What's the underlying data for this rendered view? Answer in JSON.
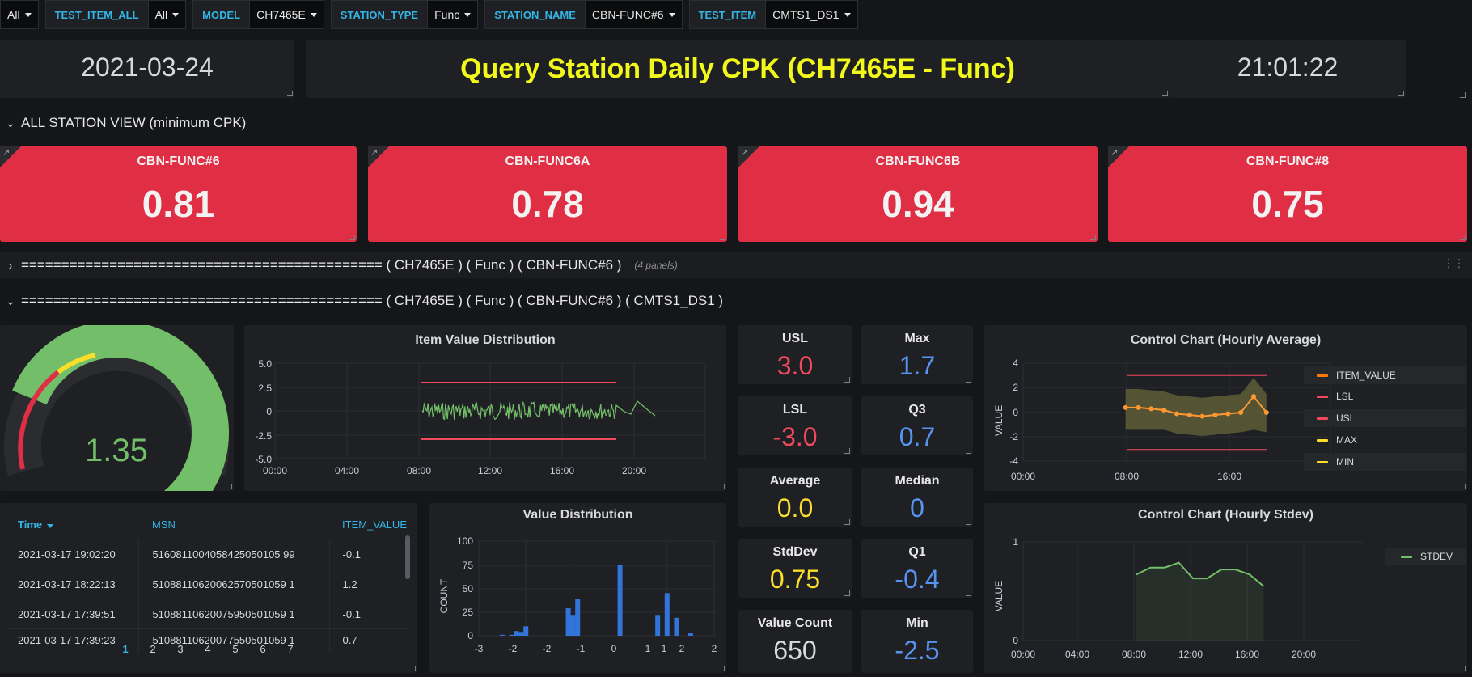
{
  "variables": [
    {
      "label": "",
      "value": "All"
    },
    {
      "label": "TEST_ITEM_ALL",
      "value": "All"
    },
    {
      "label": "MODEL",
      "value": "CH7465E"
    },
    {
      "label": "STATION_TYPE",
      "value": "Func"
    },
    {
      "label": "STATION_NAME",
      "value": "CBN-FUNC#6"
    },
    {
      "label": "TEST_ITEM",
      "value": "CMTS1_DS1"
    }
  ],
  "header": {
    "date": "2021-03-24",
    "title": "Query Station Daily CPK (CH7465E - Func)",
    "time": "21:01:22"
  },
  "rows": {
    "all_station": "ALL STATION VIEW (minimum CPK)",
    "collapsed": "============================================= ( CH7465E ) ( Func ) ( CBN-FUNC#6 )",
    "collapsed_count": "(4 panels)",
    "expanded": "============================================= ( CH7465E ) ( Func ) ( CBN-FUNC#6 ) ( CMTS1_DS1 )"
  },
  "stations": [
    {
      "name": "CBN-FUNC#6",
      "value": "0.81"
    },
    {
      "name": "CBN-FUNC6A",
      "value": "0.78"
    },
    {
      "name": "CBN-FUNC6B",
      "value": "0.94"
    },
    {
      "name": "CBN-FUNC#8",
      "value": "0.75"
    }
  ],
  "gauge": {
    "value": "1.35",
    "fraction": 0.68
  },
  "item_dist": {
    "title": "Item Value Distribution",
    "yticks": [
      "5.0",
      "2.5",
      "0",
      "-2.5",
      "-5.0"
    ],
    "xticks": [
      "00:00",
      "04:00",
      "08:00",
      "12:00",
      "16:00",
      "20:00"
    ]
  },
  "stats": {
    "usl": {
      "label": "USL",
      "value": "3.0"
    },
    "lsl": {
      "label": "LSL",
      "value": "-3.0"
    },
    "average": {
      "label": "Average",
      "value": "0.0"
    },
    "stddev": {
      "label": "StdDev",
      "value": "0.75"
    },
    "count": {
      "label": "Value Count",
      "value": "650"
    },
    "max": {
      "label": "Max",
      "value": "1.7"
    },
    "q3": {
      "label": "Q3",
      "value": "0.7"
    },
    "median": {
      "label": "Median",
      "value": "0"
    },
    "q1": {
      "label": "Q1",
      "value": "-0.4"
    },
    "min": {
      "label": "Min",
      "value": "-2.5"
    }
  },
  "control_avg": {
    "title": "Control Chart (Hourly Average)",
    "ylabel": "VALUE",
    "yticks": [
      "4",
      "2",
      "0",
      "-2",
      "-4"
    ],
    "xticks": [
      "00:00",
      "08:00",
      "16:00"
    ],
    "legend": [
      "ITEM_VALUE",
      "LSL",
      "USL",
      "MAX",
      "MIN"
    ]
  },
  "control_std": {
    "title": "Control Chart (Hourly Stdev)",
    "ylabel": "VALUE",
    "yticks": [
      "1",
      "0"
    ],
    "xticks": [
      "00:00",
      "04:00",
      "08:00",
      "12:00",
      "16:00",
      "20:00"
    ],
    "legend": [
      "STDEV"
    ]
  },
  "table": {
    "headers": [
      "Time",
      "MSN",
      "ITEM_VALUE"
    ],
    "rows": [
      [
        "2021-03-17 19:02:20",
        "5160811004058425050105 99",
        "-0.1"
      ],
      [
        "2021-03-17 18:22:13",
        "51088110620062570501059 1",
        "1.2"
      ],
      [
        "2021-03-17 17:39:51",
        "51088110620075950501059 1",
        "-0.1"
      ],
      [
        "2021-03-17 17:39:23",
        "51088110620077550501059 1",
        "0.7"
      ]
    ],
    "pages": [
      "1",
      "2",
      "3",
      "4",
      "5",
      "6",
      "7"
    ]
  },
  "value_dist": {
    "title": "Value Distribution",
    "ylabel": "COUNT",
    "yticks": [
      "100",
      "75",
      "50",
      "25",
      "0"
    ],
    "xticks": [
      "-3",
      "-2.5",
      "-2",
      "-1.5",
      "-1",
      "-0.5",
      "0",
      "0.5",
      "1",
      "1.5",
      "2"
    ],
    "xtick_labels": [
      "-3",
      "-2",
      "-2",
      "-1",
      "0",
      "1",
      "1",
      "2",
      "2"
    ]
  },
  "chart_data": [
    {
      "type": "bar",
      "title": "Value Distribution",
      "ylabel": "COUNT",
      "ylim": [
        0,
        100
      ],
      "x": [
        -2.5,
        -2.3,
        -2.2,
        -2.1,
        -2.0,
        -1.1,
        -1.0,
        -0.9,
        0.0,
        0.8,
        1.0,
        1.2,
        1.5
      ],
      "values": [
        1,
        1,
        5,
        4,
        10,
        29,
        22,
        39,
        75,
        22,
        45,
        19,
        3
      ]
    },
    {
      "type": "line",
      "title": "Control Chart (Hourly Average)",
      "ylabel": "VALUE",
      "ylim": [
        -4,
        4
      ],
      "series": [
        {
          "name": "ITEM_VALUE",
          "x": [
            8,
            9,
            10,
            11,
            12,
            13,
            14,
            15,
            16,
            17,
            18,
            19
          ],
          "values": [
            0.4,
            0.4,
            0.3,
            0.2,
            -0.1,
            -0.2,
            -0.3,
            -0.2,
            -0.1,
            0.0,
            1.3,
            0.0
          ]
        },
        {
          "name": "LSL",
          "values": [
            -3,
            -3
          ]
        },
        {
          "name": "USL",
          "values": [
            3,
            3
          ]
        }
      ]
    },
    {
      "type": "line",
      "title": "Control Chart (Hourly Stdev)",
      "ylabel": "VALUE",
      "ylim": [
        0,
        1
      ],
      "series": [
        {
          "name": "STDEV",
          "x": [
            8,
            9,
            10,
            11,
            12,
            13,
            14,
            15,
            16,
            17
          ],
          "values": [
            0.67,
            0.74,
            0.74,
            0.79,
            0.63,
            0.63,
            0.72,
            0.72,
            0.67,
            0.55
          ]
        }
      ]
    }
  ]
}
